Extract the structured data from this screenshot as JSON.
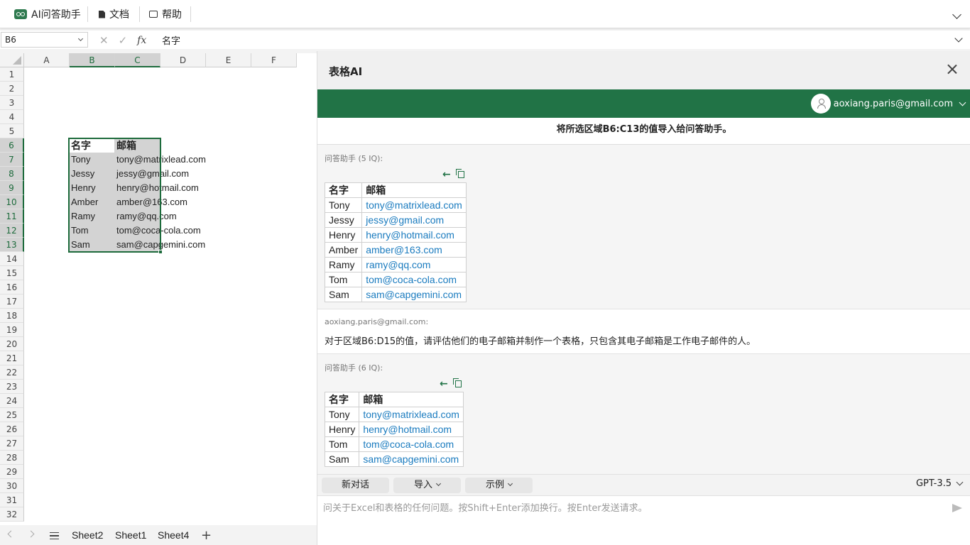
{
  "ribbon": {
    "ai_assistant": "AI问答助手",
    "docs": "文档",
    "help": "帮助"
  },
  "formula_bar": {
    "name_box": "B6",
    "fx": "fx",
    "content": "名字"
  },
  "sheet": {
    "columns": [
      "A",
      "B",
      "C",
      "D",
      "E",
      "F"
    ],
    "rows": [
      "1",
      "2",
      "3",
      "4",
      "5",
      "6",
      "7",
      "8",
      "9",
      "10",
      "11",
      "12",
      "13",
      "14",
      "15",
      "16",
      "17",
      "18",
      "19",
      "20",
      "21",
      "22",
      "23",
      "24",
      "25",
      "26",
      "27",
      "28",
      "29",
      "30",
      "31",
      "32"
    ],
    "cells": [
      {
        "name": "名字",
        "email": "邮箱"
      },
      {
        "name": "Tony",
        "email": "tony@matrixlead.com"
      },
      {
        "name": "Jessy",
        "email": "jessy@gmail.com"
      },
      {
        "name": "Henry",
        "email": "henry@hotmail.com"
      },
      {
        "name": "Amber",
        "email": "amber@163.com"
      },
      {
        "name": "Ramy",
        "email": "ramy@qq.com"
      },
      {
        "name": "Tom",
        "email": "tom@coca-cola.com"
      },
      {
        "name": "Sam",
        "email": "sam@capgemini.com"
      }
    ],
    "tabs": [
      "Sheet2",
      "Sheet1",
      "Sheet4"
    ],
    "add_tab": "+"
  },
  "panel": {
    "title": "表格AI",
    "user_email": "aoxiang.paris@gmail.com",
    "banner": "将所选区域B6:C13的值导入给问答助手。",
    "messages": [
      {
        "sender": "问答助手 (5 IQ):",
        "headers": [
          "名字",
          "邮箱"
        ],
        "rows": [
          [
            "Tony",
            "tony@matrixlead.com"
          ],
          [
            "Jessy",
            "jessy@gmail.com"
          ],
          [
            "Henry",
            "henry@hotmail.com"
          ],
          [
            "Amber",
            "amber@163.com"
          ],
          [
            "Ramy",
            "ramy@qq.com"
          ],
          [
            "Tom",
            "tom@coca-cola.com"
          ],
          [
            "Sam",
            "sam@capgemini.com"
          ]
        ]
      },
      {
        "sender": "aoxiang.paris@gmail.com:",
        "text": "对于区域B6:D15的值，请评估他们的电子邮箱并制作一个表格，只包含其电子邮箱是工作电子邮件的人。"
      },
      {
        "sender": "问答助手 (6 IQ):",
        "headers": [
          "名字",
          "邮箱"
        ],
        "rows": [
          [
            "Tony",
            "tony@matrixlead.com"
          ],
          [
            "Henry",
            "henry@hotmail.com"
          ],
          [
            "Tom",
            "tom@coca-cola.com"
          ],
          [
            "Sam",
            "sam@capgemini.com"
          ]
        ]
      }
    ],
    "toolbar": {
      "new_chat": "新对话",
      "import": "导入",
      "examples": "示例",
      "model": "GPT-3.5"
    },
    "input_placeholder": "问关于Excel和表格的任何问题。按Shift+Enter添加换行。按Enter发送请求。"
  }
}
